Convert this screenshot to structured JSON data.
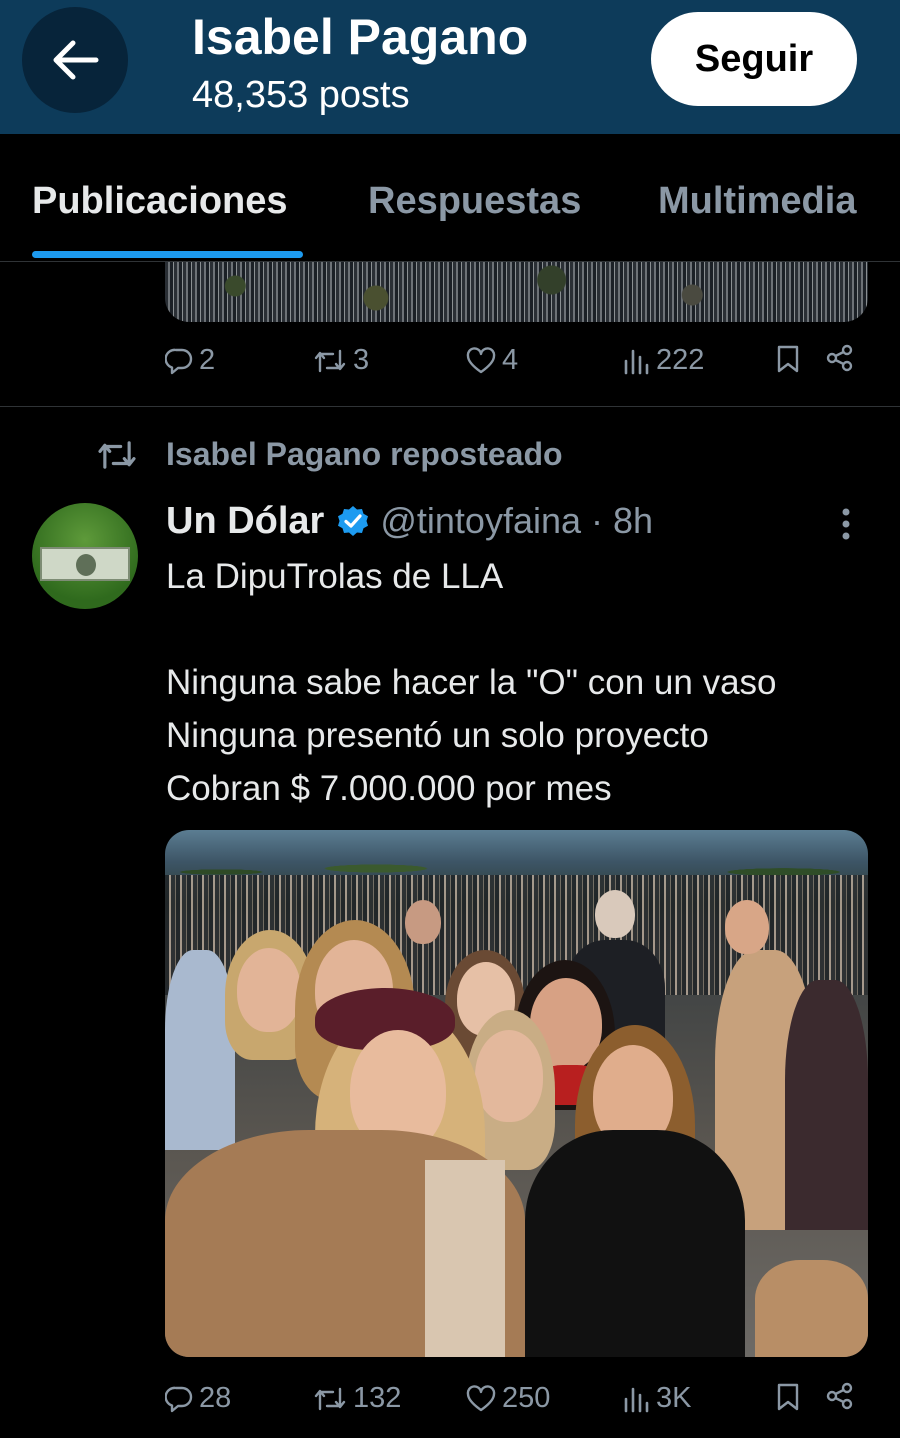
{
  "header": {
    "title": "Isabel Pagano",
    "subtitle": "48,353 posts",
    "follow_label": "Seguir"
  },
  "tabs": [
    {
      "label": "Publicaciones",
      "active": true
    },
    {
      "label": "Respuestas",
      "active": false
    },
    {
      "label": "Multimedia",
      "active": false
    }
  ],
  "previous_post": {
    "replies": "2",
    "reposts": "3",
    "likes": "4",
    "views": "222"
  },
  "repost_banner": "Isabel Pagano reposteado",
  "tweet": {
    "author_name": "Un Dólar",
    "author_meta": "@tintoyfaina · 8h",
    "lines": [
      "La DipuTrolas de LLA",
      "",
      "Ninguna sabe hacer la \"O\" con un vaso",
      "Ninguna presentó un solo proyecto",
      "Cobran $ 7.000.000 por mes"
    ],
    "replies": "28",
    "reposts": "132",
    "likes": "250",
    "views": "3K"
  },
  "colors": {
    "header_bg": "#0d3b5a",
    "accent": "#1d9bf0",
    "muted": "#8b98a5"
  },
  "icons": [
    "back-arrow-icon",
    "reply-icon",
    "repost-icon",
    "like-icon",
    "views-icon",
    "bookmark-icon",
    "share-icon",
    "verified-icon",
    "more-icon"
  ]
}
